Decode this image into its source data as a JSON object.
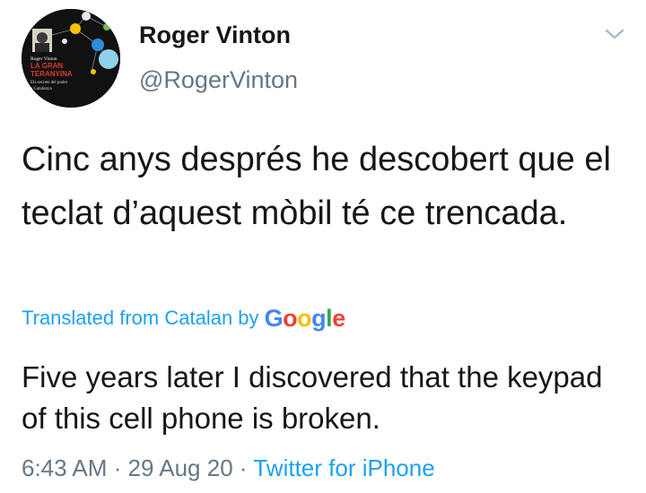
{
  "author": {
    "name": "Roger Vinton",
    "handle": "@RogerVinton",
    "avatar_book": {
      "author_line": "Roger Vinton",
      "title_line1": "LA GRAN",
      "title_line2": "TERANYINA",
      "subtitle_line1": "Els secrets del poder",
      "subtitle_line2": "a Catalunya"
    }
  },
  "menu_icon": "chevron-down-icon",
  "tweet": {
    "text": "Cinc anys després he descobert que el teclat d’aquest mòbil té ce trencada.",
    "translation_label": "Translated from Catalan by",
    "translation_provider": "Google",
    "translated_text": "Five years later I discovered that the keypad of this cell phone is broken."
  },
  "meta": {
    "time": "6:43 AM",
    "date": "29 Aug 20",
    "separator": "·",
    "source": "Twitter for iPhone"
  },
  "colors": {
    "link": "#1da1f2",
    "secondary_text": "#657786",
    "primary_text": "#14171a",
    "google_blue": "#4285f4",
    "google_red": "#ea4335",
    "google_yellow": "#fbbc05",
    "google_green": "#34a853"
  }
}
